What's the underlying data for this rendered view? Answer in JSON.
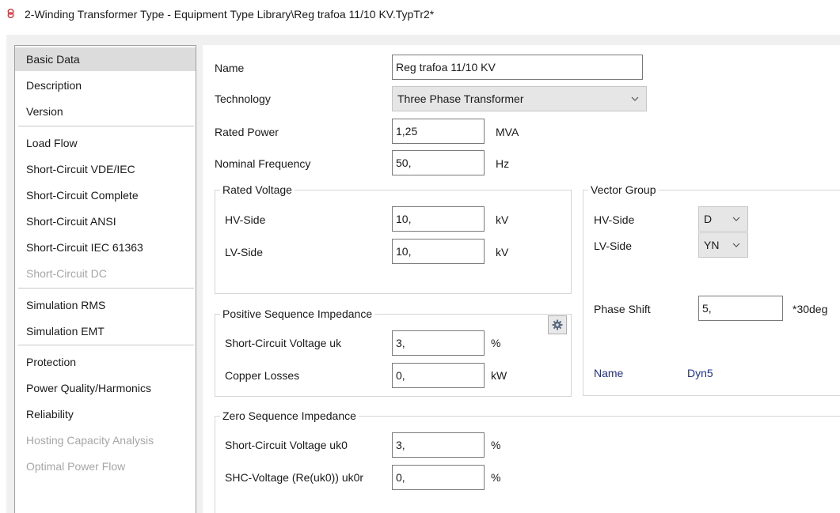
{
  "window": {
    "title": "2-Winding Transformer Type - Equipment Type Library\\Reg trafoa 11/10 KV.TypTr2*"
  },
  "sidebar": {
    "items": [
      {
        "label": "Basic Data",
        "state": "selected"
      },
      {
        "label": "Description",
        "state": "normal"
      },
      {
        "label": "Version",
        "state": "normal"
      },
      {
        "label": "Load Flow",
        "state": "normal"
      },
      {
        "label": "Short-Circuit VDE/IEC",
        "state": "normal"
      },
      {
        "label": "Short-Circuit Complete",
        "state": "normal"
      },
      {
        "label": "Short-Circuit ANSI",
        "state": "normal"
      },
      {
        "label": "Short-Circuit IEC 61363",
        "state": "normal"
      },
      {
        "label": "Short-Circuit DC",
        "state": "disabled"
      },
      {
        "label": "Simulation RMS",
        "state": "normal"
      },
      {
        "label": "Simulation EMT",
        "state": "normal"
      },
      {
        "label": "Protection",
        "state": "normal"
      },
      {
        "label": "Power Quality/Harmonics",
        "state": "normal"
      },
      {
        "label": "Reliability",
        "state": "normal"
      },
      {
        "label": "Hosting Capacity Analysis",
        "state": "disabled"
      },
      {
        "label": "Optimal Power Flow",
        "state": "disabled"
      }
    ]
  },
  "form": {
    "name": {
      "label": "Name",
      "value": "Reg trafoa 11/10 KV"
    },
    "technology": {
      "label": "Technology",
      "value": "Three Phase Transformer"
    },
    "rated_power": {
      "label": "Rated Power",
      "value": "1,25",
      "unit": "MVA"
    },
    "nominal_frequency": {
      "label": "Nominal Frequency",
      "value": "50,",
      "unit": "Hz"
    },
    "rated_voltage": {
      "title": "Rated Voltage",
      "hv": {
        "label": "HV-Side",
        "value": "10,",
        "unit": "kV"
      },
      "lv": {
        "label": "LV-Side",
        "value": "10,",
        "unit": "kV"
      }
    },
    "positive_sequence": {
      "title": "Positive Sequence Impedance",
      "uk": {
        "label": "Short-Circuit Voltage uk",
        "value": "3,",
        "unit": "%"
      },
      "copper": {
        "label": "Copper Losses",
        "value": "0,",
        "unit": "kW"
      }
    },
    "zero_sequence": {
      "title": "Zero Sequence Impedance",
      "uk0": {
        "label": "Short-Circuit Voltage uk0",
        "value": "3,",
        "unit": "%"
      },
      "uk0r": {
        "label": "SHC-Voltage (Re(uk0)) uk0r",
        "value": "0,",
        "unit": "%"
      }
    },
    "vector_group": {
      "title": "Vector Group",
      "hv": {
        "label": "HV-Side",
        "value": "D"
      },
      "lv": {
        "label": "LV-Side",
        "value": "YN"
      },
      "phase_shift": {
        "label": "Phase Shift",
        "value": "5,",
        "unit": "*30deg"
      },
      "name": {
        "label": "Name",
        "value": "Dyn5"
      }
    }
  },
  "colors": {
    "selected_bg": "#dcdcdc",
    "disabled_text": "#a6a6a6",
    "link_text": "#1f2f8f",
    "title_icon": "#d0343a"
  },
  "icons": [
    "transformer-icon",
    "chevron-down-icon",
    "gear-icon"
  ]
}
